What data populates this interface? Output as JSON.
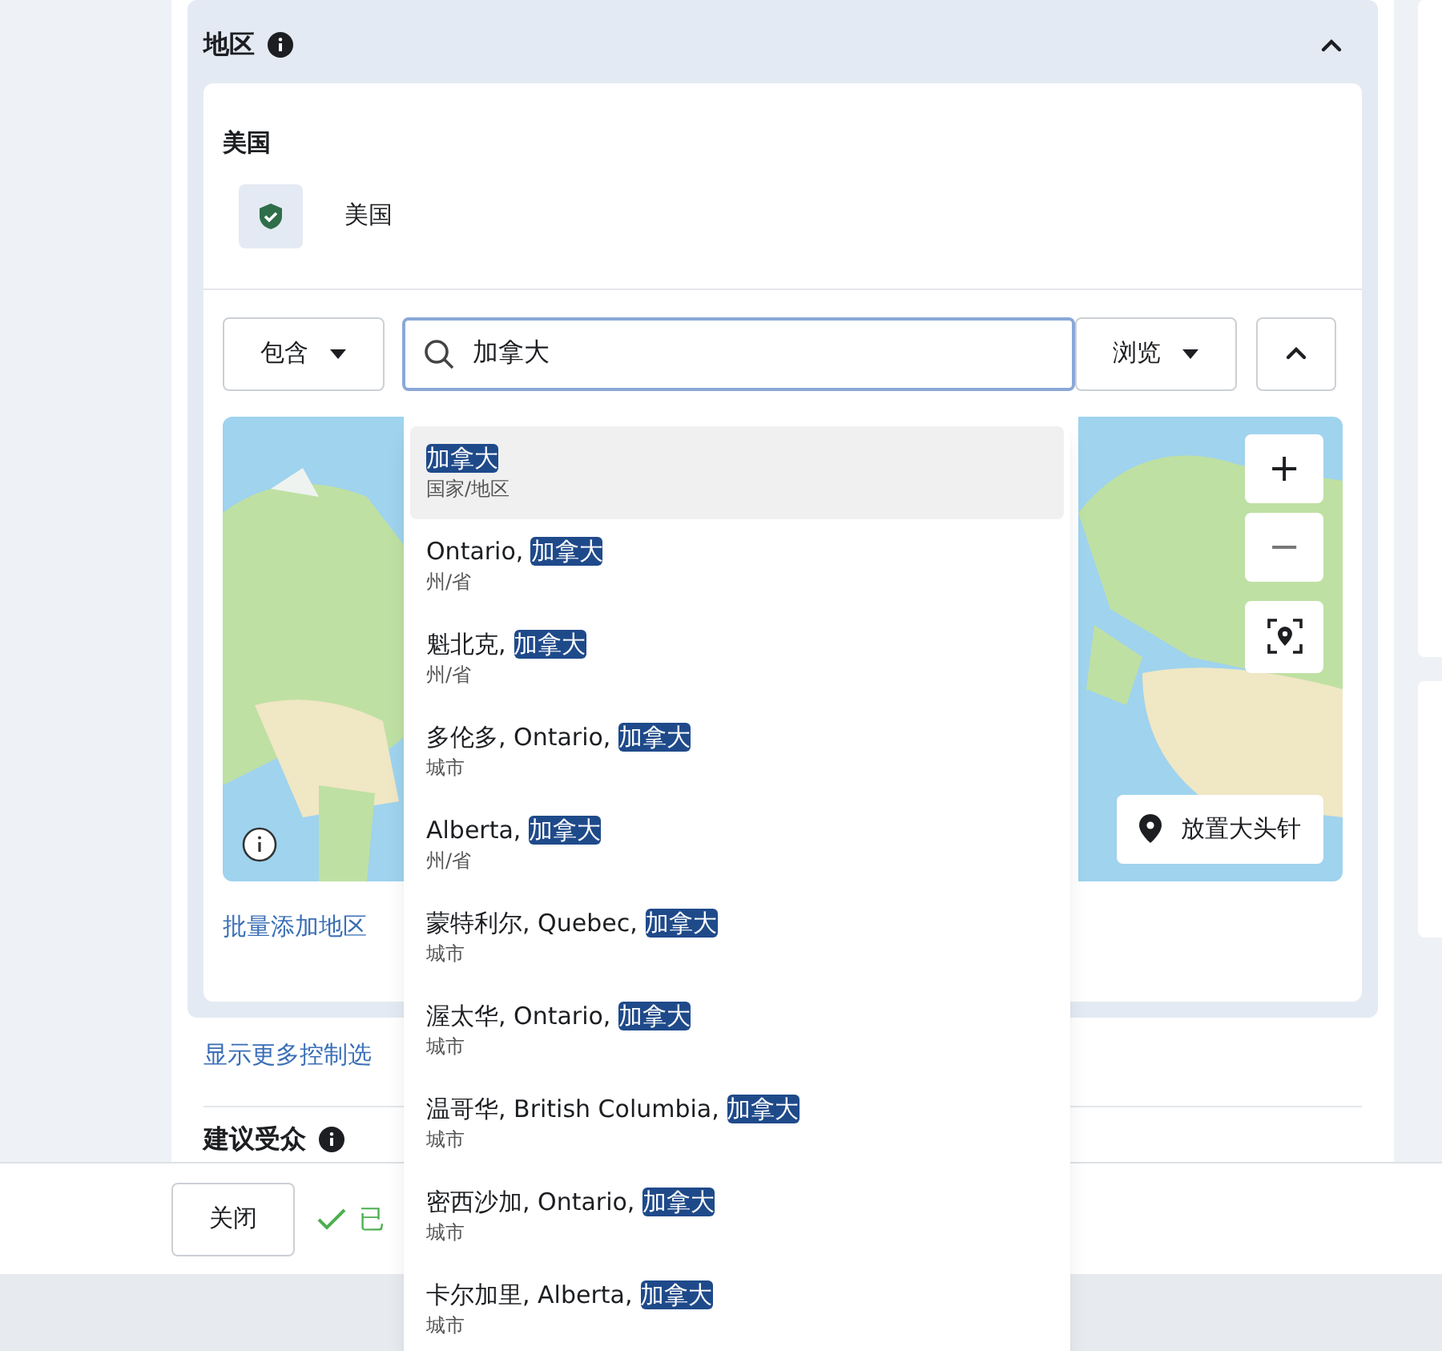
{
  "section": {
    "title": "地区",
    "expanded": true
  },
  "included": {
    "heading": "美国",
    "items": [
      {
        "name": "美国"
      }
    ]
  },
  "controls": {
    "mode": "包含",
    "search_value": "加拿大",
    "browse": "浏览"
  },
  "map": {
    "zoom_in": "+",
    "zoom_out": "−",
    "place_pin": "放置大头针"
  },
  "bulk_add_link": "批量添加地区",
  "more_controls_link": "显示更多控制选",
  "next_section": {
    "title": "建议受众"
  },
  "footer": {
    "close": "关闭",
    "status": "已"
  },
  "dropdown": [
    {
      "parts": [
        {
          "text": "加拿大",
          "match": true
        }
      ],
      "type": "国家/地区",
      "selected": true
    },
    {
      "parts": [
        {
          "text": "Ontario, ",
          "match": false
        },
        {
          "text": "加拿大",
          "match": true
        }
      ],
      "type": "州/省",
      "selected": false
    },
    {
      "parts": [
        {
          "text": "魁北克, ",
          "match": false
        },
        {
          "text": "加拿大",
          "match": true
        }
      ],
      "type": "州/省",
      "selected": false
    },
    {
      "parts": [
        {
          "text": "多伦多, Ontario, ",
          "match": false
        },
        {
          "text": "加拿大",
          "match": true
        }
      ],
      "type": "城市",
      "selected": false
    },
    {
      "parts": [
        {
          "text": "Alberta, ",
          "match": false
        },
        {
          "text": "加拿大",
          "match": true
        }
      ],
      "type": "州/省",
      "selected": false
    },
    {
      "parts": [
        {
          "text": "蒙特利尔, Quebec, ",
          "match": false
        },
        {
          "text": "加拿大",
          "match": true
        }
      ],
      "type": "城市",
      "selected": false
    },
    {
      "parts": [
        {
          "text": "渥太华, Ontario, ",
          "match": false
        },
        {
          "text": "加拿大",
          "match": true
        }
      ],
      "type": "城市",
      "selected": false
    },
    {
      "parts": [
        {
          "text": "温哥华, British Columbia, ",
          "match": false
        },
        {
          "text": "加拿大",
          "match": true
        }
      ],
      "type": "城市",
      "selected": false
    },
    {
      "parts": [
        {
          "text": "密西沙加, Ontario, ",
          "match": false
        },
        {
          "text": "加拿大",
          "match": true
        }
      ],
      "type": "城市",
      "selected": false
    },
    {
      "parts": [
        {
          "text": "卡尔加里, Alberta, ",
          "match": false
        },
        {
          "text": "加拿大",
          "match": true
        }
      ],
      "type": "城市",
      "selected": false
    }
  ]
}
